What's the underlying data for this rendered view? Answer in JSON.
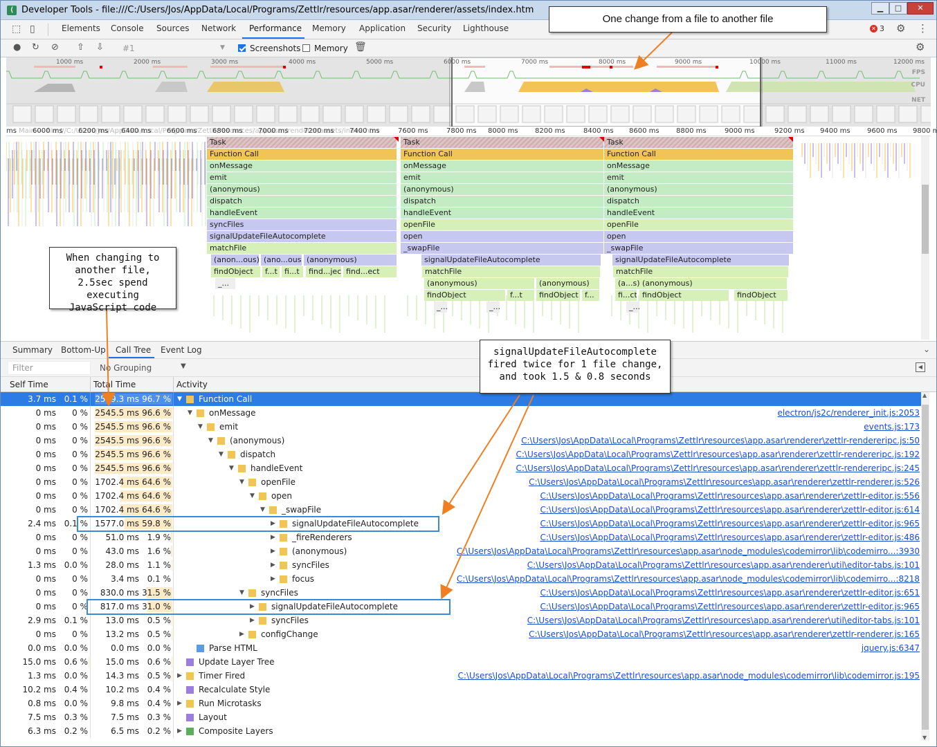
{
  "window": {
    "title": "Developer Tools - file:///C:/Users/Jos/AppData/Local/Programs/Zettlr/resources/app.asar/renderer/assets/index.htm",
    "app_icon": "devtools-icon",
    "minimize": "▁",
    "maximize": "□",
    "close": "✕"
  },
  "tabs": [
    "Elements",
    "Console",
    "Sources",
    "Network",
    "Performance",
    "Memory",
    "Application",
    "Security",
    "Lighthouse"
  ],
  "active_tab": "Performance",
  "error_badge": "3",
  "toolbar": {
    "profile_select": "#1",
    "screenshots_label": "Screenshots",
    "screenshots_checked": true,
    "memory_label": "Memory",
    "memory_checked": false
  },
  "overview": {
    "ticks": [
      "1000 ms",
      "2000 ms",
      "3000 ms",
      "4000 ms",
      "5000 ms",
      "6000 ms",
      "7000 ms",
      "8000 ms",
      "9000 ms",
      "10000 ms",
      "11000 ms",
      "12000 ms"
    ],
    "labels": [
      "FPS",
      "CPU",
      "NET"
    ]
  },
  "ruler_ticks": [
    "ms",
    "6000 ms",
    "6200 ms",
    "6400 ms",
    "6600 ms",
    "6800 ms",
    "7000 ms",
    "7200 ms",
    "7400 ms",
    "7600 ms",
    "7800 ms",
    "8000 ms",
    "8200 ms",
    "8400 ms",
    "8600 ms",
    "8800 ms",
    "9000 ms",
    "9200 ms",
    "9400 ms",
    "9600 ms",
    "9800 m"
  ],
  "ruler_ghost": "Main — file:///C:/Users/Jos/AppData/Local/Programs/Zettlr/resources/app.asar/renderer/assets/index.htm",
  "flame": {
    "col1": [
      [
        "Task",
        "#d8c6c6"
      ],
      [
        "Function Call",
        "#f0c455"
      ],
      [
        "onMessage",
        "#c4ecc4"
      ],
      [
        "emit",
        "#c4ecc4"
      ],
      [
        "(anonymous)",
        "#c4ecc4"
      ],
      [
        "dispatch",
        "#c4ecc4"
      ],
      [
        "handleEvent",
        "#c4ecc4"
      ],
      [
        "syncFiles",
        "#c6c8f0"
      ],
      [
        "signalUpdateFileAutocomplete",
        "#c6c8f0"
      ],
      [
        "matchFile",
        "#d6f0b8"
      ]
    ],
    "col2": [
      [
        "Task",
        "#d8c6c6"
      ],
      [
        "Function Call",
        "#f0c455"
      ],
      [
        "onMessage",
        "#c4ecc4"
      ],
      [
        "emit",
        "#c4ecc4"
      ],
      [
        "(anonymous)",
        "#c4ecc4"
      ],
      [
        "dispatch",
        "#c4ecc4"
      ],
      [
        "handleEvent",
        "#c4ecc4"
      ],
      [
        "openFile",
        "#d6f0b8"
      ],
      [
        "open",
        "#c6c8f0"
      ],
      [
        "_swapFile",
        "#c6c8f0"
      ]
    ],
    "col3": [
      [
        "Task",
        "#d8c6c6"
      ],
      [
        "Function Call",
        "#f0c455"
      ],
      [
        "onMessage",
        "#c4ecc4"
      ],
      [
        "emit",
        "#c4ecc4"
      ],
      [
        "(anonymous)",
        "#c4ecc4"
      ],
      [
        "dispatch",
        "#c4ecc4"
      ],
      [
        "handleEvent",
        "#c4ecc4"
      ],
      [
        "openFile",
        "#d6f0b8"
      ],
      [
        "open",
        "#c6c8f0"
      ],
      [
        "_swapFile",
        "#c6c8f0"
      ]
    ],
    "extra": {
      "r10a": "(anon...ous)",
      "r10b": "(ano...ous)",
      "r10c": "(anonymous)",
      "r11a": "findObject",
      "r11b": "f...t",
      "r11c": "fi...t",
      "r11d": "find...ject",
      "r11e": "find...ect",
      "r12a": "_...",
      "c2r10": "signalUpdateFileAutocomplete",
      "c2r11": "matchFile",
      "c2r12a": "(anonymous)",
      "c2r12b": "(anonymous)",
      "c2r13a": "findObject",
      "c2r13b": "f...t",
      "c2r13c": "findObject",
      "c2r13d": "f...",
      "c2r14a": "_...",
      "c2r14b": "_...",
      "c3r10": "signalUpdateFileAutocomplete",
      "c3r11": "matchFile",
      "c3r12a": "(a...s)",
      "c3r12b": "(anonymous)",
      "c3r13a": "fi...ct",
      "c3r13b": "findObject",
      "c3r13c": "findObject",
      "c3r14a": "_..."
    }
  },
  "bottom_tabs": [
    "Summary",
    "Bottom-Up",
    "Call Tree",
    "Event Log"
  ],
  "active_bottom_tab": "Call Tree",
  "filter_placeholder": "Filter",
  "grouping": "No Grouping",
  "columns": {
    "self": "Self Time",
    "total": "Total Time",
    "activity": "Activity"
  },
  "tree_rows": [
    {
      "self": "3.7 ms",
      "selfp": "0.1 %",
      "sfrac": 0.001,
      "total": "2549.3 ms",
      "totalp": "96.7 %",
      "tfrac": 0.967,
      "depth": 0,
      "arrow": "▼",
      "color": "#f0c455",
      "name": "Function Call",
      "url": "",
      "sel": true
    },
    {
      "self": "0 ms",
      "selfp": "0 %",
      "sfrac": 0,
      "total": "2545.5 ms",
      "totalp": "96.6 %",
      "tfrac": 0.966,
      "depth": 1,
      "arrow": "▼",
      "color": "#f0c455",
      "name": "onMessage",
      "url": "electron/js2c/renderer_init.js:2053"
    },
    {
      "self": "0 ms",
      "selfp": "0 %",
      "sfrac": 0,
      "total": "2545.5 ms",
      "totalp": "96.6 %",
      "tfrac": 0.966,
      "depth": 2,
      "arrow": "▼",
      "color": "#f0c455",
      "name": "emit",
      "url": "events.js:173"
    },
    {
      "self": "0 ms",
      "selfp": "0 %",
      "sfrac": 0,
      "total": "2545.5 ms",
      "totalp": "96.6 %",
      "tfrac": 0.966,
      "depth": 3,
      "arrow": "▼",
      "color": "#f0c455",
      "name": "(anonymous)",
      "url": "C:\\Users\\Jos\\AppData\\Local\\Programs\\Zettlr\\resources\\app.asar\\renderer\\zettlr-rendereripc.js:50"
    },
    {
      "self": "0 ms",
      "selfp": "0 %",
      "sfrac": 0,
      "total": "2545.5 ms",
      "totalp": "96.6 %",
      "tfrac": 0.966,
      "depth": 4,
      "arrow": "▼",
      "color": "#f0c455",
      "name": "dispatch",
      "url": "C:\\Users\\Jos\\AppData\\Local\\Programs\\Zettlr\\resources\\app.asar\\renderer\\zettlr-rendereripc.js:192"
    },
    {
      "self": "0 ms",
      "selfp": "0 %",
      "sfrac": 0,
      "total": "2545.5 ms",
      "totalp": "96.6 %",
      "tfrac": 0.966,
      "depth": 5,
      "arrow": "▼",
      "color": "#f0c455",
      "name": "handleEvent",
      "url": "C:\\Users\\Jos\\AppData\\Local\\Programs\\Zettlr\\resources\\app.asar\\renderer\\zettlr-rendereripc.js:245"
    },
    {
      "self": "0 ms",
      "selfp": "0 %",
      "sfrac": 0,
      "total": "1702.4 ms",
      "totalp": "64.6 %",
      "tfrac": 0.646,
      "depth": 6,
      "arrow": "▼",
      "color": "#f0c455",
      "name": "openFile",
      "url": "C:\\Users\\Jos\\AppData\\Local\\Programs\\Zettlr\\resources\\app.asar\\renderer\\zettlr-renderer.js:526"
    },
    {
      "self": "0 ms",
      "selfp": "0 %",
      "sfrac": 0,
      "total": "1702.4 ms",
      "totalp": "64.6 %",
      "tfrac": 0.646,
      "depth": 7,
      "arrow": "▼",
      "color": "#f0c455",
      "name": "open",
      "url": "C:\\Users\\Jos\\AppData\\Local\\Programs\\Zettlr\\resources\\app.asar\\renderer\\zettlr-editor.js:556"
    },
    {
      "self": "0 ms",
      "selfp": "0 %",
      "sfrac": 0,
      "total": "1702.4 ms",
      "totalp": "64.6 %",
      "tfrac": 0.646,
      "depth": 8,
      "arrow": "▼",
      "color": "#f0c455",
      "name": "_swapFile",
      "url": "C:\\Users\\Jos\\AppData\\Local\\Programs\\Zettlr\\resources\\app.asar\\renderer\\zettlr-editor.js:614"
    },
    {
      "self": "2.4 ms",
      "selfp": "0.1 %",
      "sfrac": 0.001,
      "total": "1577.0 ms",
      "totalp": "59.8 %",
      "tfrac": 0.598,
      "depth": 9,
      "arrow": "▶",
      "color": "#f0c455",
      "name": "signalUpdateFileAutocomplete",
      "url": "C:\\Users\\Jos\\AppData\\Local\\Programs\\Zettlr\\resources\\app.asar\\renderer\\zettlr-editor.js:965"
    },
    {
      "self": "0 ms",
      "selfp": "0 %",
      "sfrac": 0,
      "total": "51.0 ms",
      "totalp": "1.9 %",
      "tfrac": 0.019,
      "depth": 9,
      "arrow": "▶",
      "color": "#f0c455",
      "name": "_fireRenderers",
      "url": "C:\\Users\\Jos\\AppData\\Local\\Programs\\Zettlr\\resources\\app.asar\\renderer\\zettlr-editor.js:486"
    },
    {
      "self": "0 ms",
      "selfp": "0 %",
      "sfrac": 0,
      "total": "43.0 ms",
      "totalp": "1.6 %",
      "tfrac": 0.016,
      "depth": 9,
      "arrow": "▶",
      "color": "#f0c455",
      "name": "(anonymous)",
      "url": "C:\\Users\\Jos\\AppData\\Local\\Programs\\Zettlr\\resources\\app.asar\\node_modules\\codemirror\\lib\\codemirro...:3930"
    },
    {
      "self": "1.3 ms",
      "selfp": "0.0 %",
      "sfrac": 0.0005,
      "total": "28.0 ms",
      "totalp": "1.1 %",
      "tfrac": 0.011,
      "depth": 9,
      "arrow": "▶",
      "color": "#f0c455",
      "name": "syncFiles",
      "url": "C:\\Users\\Jos\\AppData\\Local\\Programs\\Zettlr\\resources\\app.asar\\renderer\\util\\editor-tabs.js:101"
    },
    {
      "self": "0 ms",
      "selfp": "0 %",
      "sfrac": 0,
      "total": "3.4 ms",
      "totalp": "0.1 %",
      "tfrac": 0.001,
      "depth": 9,
      "arrow": "▶",
      "color": "#f0c455",
      "name": "focus",
      "url": "C:\\Users\\Jos\\AppData\\Local\\Programs\\Zettlr\\resources\\app.asar\\node_modules\\codemirror\\lib\\codemirro...:8218"
    },
    {
      "self": "0 ms",
      "selfp": "0 %",
      "sfrac": 0,
      "total": "830.0 ms",
      "totalp": "31.5 %",
      "tfrac": 0.315,
      "depth": 6,
      "arrow": "▼",
      "color": "#f0c455",
      "name": "syncFiles",
      "url": "C:\\Users\\Jos\\AppData\\Local\\Programs\\Zettlr\\resources\\app.asar\\renderer\\zettlr-editor.js:651"
    },
    {
      "self": "0 ms",
      "selfp": "0 %",
      "sfrac": 0,
      "total": "817.0 ms",
      "totalp": "31.0 %",
      "tfrac": 0.31,
      "depth": 7,
      "arrow": "▶",
      "color": "#f0c455",
      "name": "signalUpdateFileAutocomplete",
      "url": "C:\\Users\\Jos\\AppData\\Local\\Programs\\Zettlr\\resources\\app.asar\\renderer\\zettlr-editor.js:965"
    },
    {
      "self": "2.9 ms",
      "selfp": "0.1 %",
      "sfrac": 0.001,
      "total": "13.0 ms",
      "totalp": "0.5 %",
      "tfrac": 0.005,
      "depth": 7,
      "arrow": "▶",
      "color": "#f0c455",
      "name": "syncFiles",
      "url": "C:\\Users\\Jos\\AppData\\Local\\Programs\\Zettlr\\resources\\app.asar\\renderer\\util\\editor-tabs.js:101"
    },
    {
      "self": "0 ms",
      "selfp": "0 %",
      "sfrac": 0,
      "total": "13.2 ms",
      "totalp": "0.5 %",
      "tfrac": 0.005,
      "depth": 6,
      "arrow": "▶",
      "color": "#f0c455",
      "name": "configChange",
      "url": "C:\\Users\\Jos\\AppData\\Local\\Programs\\Zettlr\\resources\\app.asar\\renderer\\zettlr-renderer.js:165"
    },
    {
      "self": "0.0 ms",
      "selfp": "0.0 %",
      "sfrac": 0,
      "total": "0.0 ms",
      "totalp": "0.0 %",
      "tfrac": 0,
      "depth": 1,
      "arrow": "",
      "color": "#5b9be0",
      "name": "Parse HTML",
      "url": "jquery.js:6347"
    },
    {
      "self": "15.0 ms",
      "selfp": "0.6 %",
      "sfrac": 0.006,
      "total": "15.0 ms",
      "totalp": "0.6 %",
      "tfrac": 0.006,
      "depth": 0,
      "arrow": "",
      "color": "#9b7ee0",
      "name": "Update Layer Tree",
      "url": ""
    },
    {
      "self": "1.3 ms",
      "selfp": "0.0 %",
      "sfrac": 0.0005,
      "total": "14.3 ms",
      "totalp": "0.5 %",
      "tfrac": 0.005,
      "depth": 0,
      "arrow": "▶",
      "color": "#f0c455",
      "name": "Timer Fired",
      "url": "C:\\Users\\Jos\\AppData\\Local\\Programs\\Zettlr\\resources\\app.asar\\node_modules\\codemirror\\lib\\codemirror.js:195"
    },
    {
      "self": "10.2 ms",
      "selfp": "0.4 %",
      "sfrac": 0.004,
      "total": "10.2 ms",
      "totalp": "0.4 %",
      "tfrac": 0.004,
      "depth": 0,
      "arrow": "",
      "color": "#9b7ee0",
      "name": "Recalculate Style",
      "url": ""
    },
    {
      "self": "0.8 ms",
      "selfp": "0.0 %",
      "sfrac": 0.0003,
      "total": "9.8 ms",
      "totalp": "0.4 %",
      "tfrac": 0.004,
      "depth": 0,
      "arrow": "▶",
      "color": "#f0c455",
      "name": "Run Microtasks",
      "url": ""
    },
    {
      "self": "7.5 ms",
      "selfp": "0.3 %",
      "sfrac": 0.003,
      "total": "7.5 ms",
      "totalp": "0.3 %",
      "tfrac": 0.003,
      "depth": 0,
      "arrow": "",
      "color": "#9b7ee0",
      "name": "Layout",
      "url": ""
    },
    {
      "self": "6.3 ms",
      "selfp": "0.2 %",
      "sfrac": 0.002,
      "total": "6.5 ms",
      "totalp": "0.2 %",
      "tfrac": 0.002,
      "depth": 0,
      "arrow": "▶",
      "color": "#5cae5c",
      "name": "Composite Layers",
      "url": ""
    }
  ],
  "callouts": {
    "top": "One change from a file to another file",
    "left": "When changing to another file, 2.5sec spend executing JavaScript code",
    "right": "signalUpdateFileAutocomplete fired twice for 1 file change, and took 1.5 & 0.8 seconds"
  },
  "colors": {
    "accent": "#1a73e8",
    "selection": "#2d7be5",
    "annotation_arrow": "#f07f22",
    "highlight_box": "#3a8ad8"
  }
}
